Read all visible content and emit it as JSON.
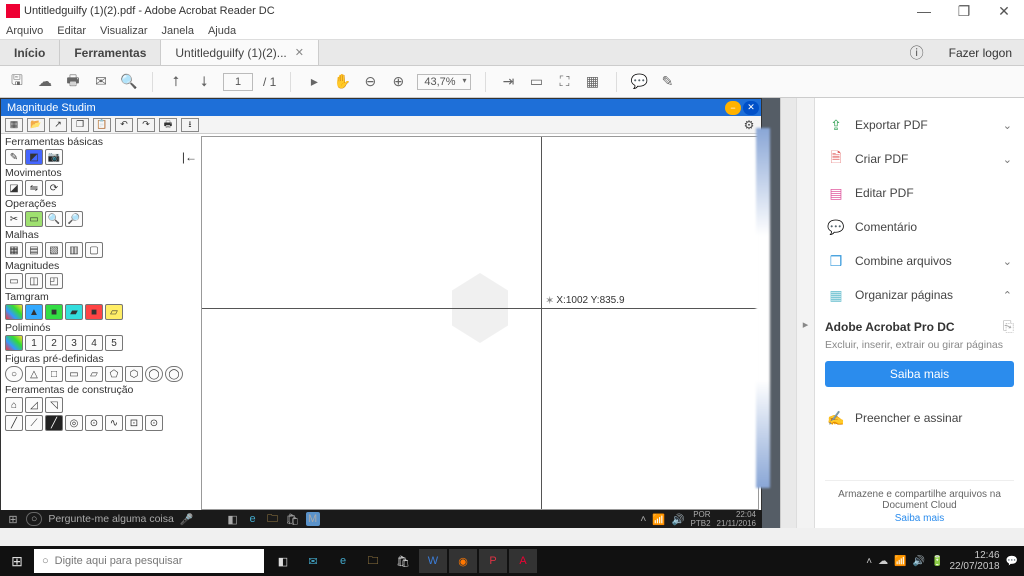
{
  "window": {
    "title": "Untitledguilfy (1)(2).pdf - Adobe Acrobat Reader DC",
    "min": "—",
    "max": "❐",
    "close": "✕"
  },
  "menu": [
    "Arquivo",
    "Editar",
    "Visualizar",
    "Janela",
    "Ajuda"
  ],
  "tabs": {
    "home": "Início",
    "tools": "Ferramentas",
    "doc": "Untitledguilfy (1)(2)...",
    "logon": "Fazer logon"
  },
  "toolbar": {
    "page_current": "1",
    "page_total": "/ 1",
    "zoom": "43,7%"
  },
  "magnitude": {
    "title": "Magnitude Studim",
    "groups": {
      "basicas": "Ferramentas básicas",
      "movimentos": "Movimentos",
      "operacoes": "Operações",
      "malhas": "Malhas",
      "magnitudes": "Magnitudes",
      "tamgram": "Tamgram",
      "poliminos": "Poliminós",
      "figuras": "Figuras pré-definidas",
      "construcao": "Ferramentas de construção"
    },
    "polimino_nums": [
      "1",
      "2",
      "3",
      "4",
      "5"
    ],
    "coord": "X:1002  Y:835.9"
  },
  "docbar": {
    "search_placeholder": "Pergunte-me alguma coisa",
    "lang1": "POR",
    "lang2": "PTB2",
    "time": "22:04",
    "date": "21/11/2016"
  },
  "rpanel": {
    "export": "Exportar PDF",
    "create": "Criar PDF",
    "edit": "Editar PDF",
    "comment": "Comentário",
    "combine": "Combine arquivos",
    "organize": "Organizar páginas",
    "fill": "Preencher e assinar",
    "pro_title": "Adobe Acrobat Pro DC",
    "pro_sub": "Excluir, inserir, extrair ou girar páginas",
    "pro_btn": "Saiba mais",
    "store1": "Armazene e compartilhe arquivos na Document Cloud",
    "store_link": "Saiba mais"
  },
  "taskbar": {
    "search_placeholder": "Digite aqui para pesquisar",
    "time": "12:46",
    "date": "22/07/2018"
  }
}
